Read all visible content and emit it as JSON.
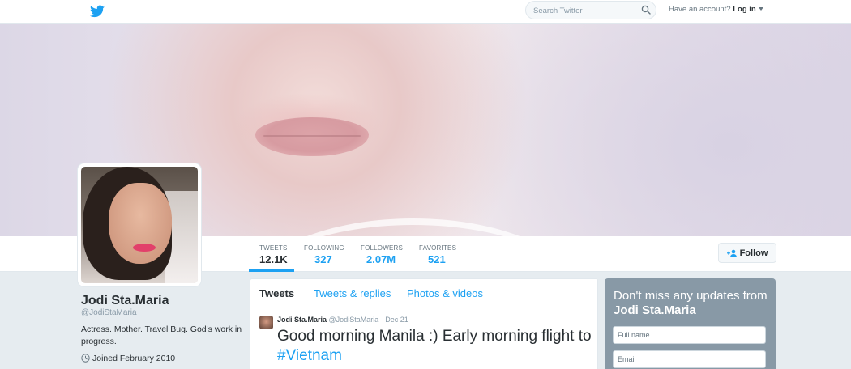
{
  "nav": {
    "search_placeholder": "Search Twitter",
    "account_prompt": "Have an account?",
    "login_label": "Log in"
  },
  "profile": {
    "name": "Jodi Sta.Maria",
    "handle": "@JodiStaMaria",
    "bio": "Actress. Mother. Travel Bug. God's work in progress.",
    "joined": "Joined February 2010",
    "follow_label": "Follow"
  },
  "stats": [
    {
      "label": "TWEETS",
      "value": "12.1K"
    },
    {
      "label": "FOLLOWING",
      "value": "327"
    },
    {
      "label": "FOLLOWERS",
      "value": "2.07M"
    },
    {
      "label": "FAVORITES",
      "value": "521"
    }
  ],
  "timeline": {
    "tabs": [
      "Tweets",
      "Tweets & replies",
      "Photos & videos"
    ],
    "tweet": {
      "author": "Jodi Sta.Maria",
      "meta": "@JodiStaMaria · Dec 21",
      "text": "Good morning Manila :) Early morning flight to ",
      "hashtag": "#Vietnam"
    }
  },
  "signup": {
    "title_prefix": "Don't miss any updates from ",
    "title_name": "Jodi Sta.Maria",
    "fullname_placeholder": "Full name",
    "email_placeholder": "Email"
  },
  "colors": {
    "accent": "#1da1f2",
    "signup_bg": "#8899a6"
  }
}
